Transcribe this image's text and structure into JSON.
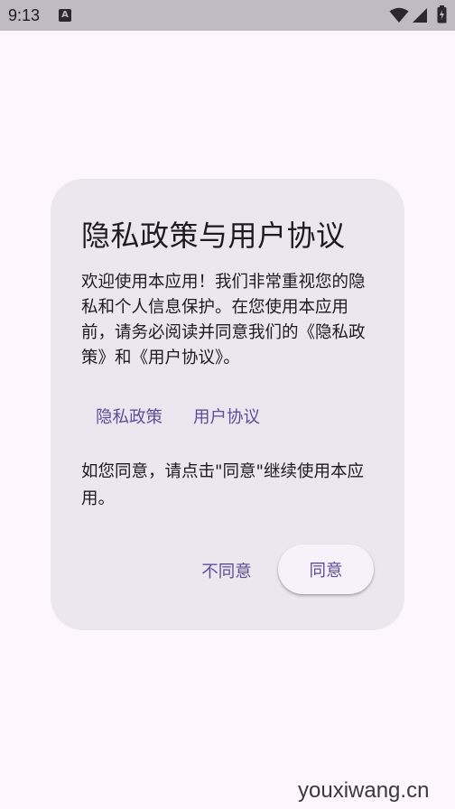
{
  "status_bar": {
    "time": "9:13",
    "notification_icon": "text-a-icon",
    "icons": [
      "wifi-icon",
      "signal-icon",
      "battery-icon"
    ]
  },
  "dialog": {
    "title": "隐私政策与用户协议",
    "body": "欢迎使用本应用！我们非常重视您的隐私和个人信息保护。在您使用本应用前，请务必阅读并同意我们的《隐私政策》和《用户协议》。",
    "links": [
      "隐私政策",
      "用户协议"
    ],
    "footer_text": "如您同意，请点击\"同意\"继续使用本应用。",
    "disagree_label": "不同意",
    "agree_label": "同意"
  },
  "watermark": "youxiwang.cn",
  "colors": {
    "background": "#fdf7fd",
    "dialog_bg": "#ece6ee",
    "accent": "#5c4f9a",
    "status_bar_bg": "#bebbc2"
  }
}
